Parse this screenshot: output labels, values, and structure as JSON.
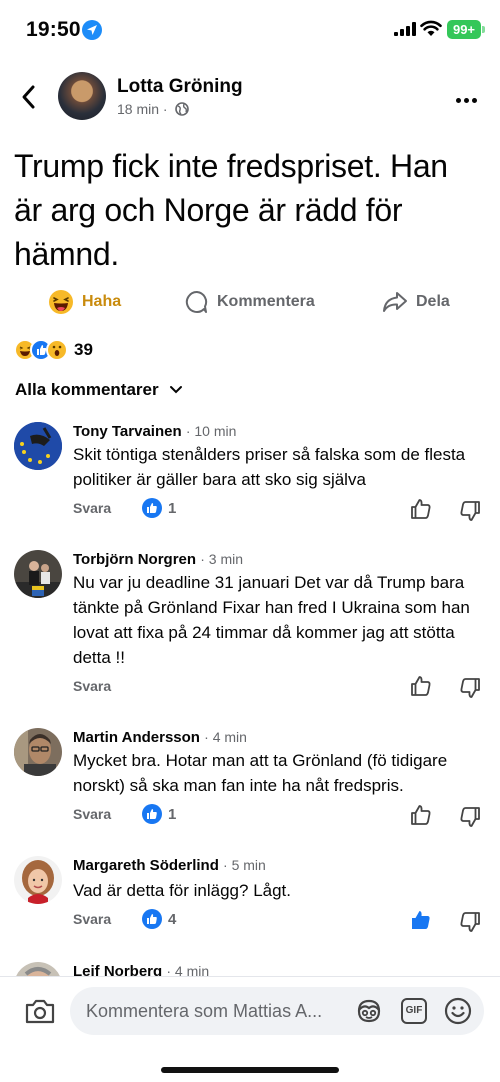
{
  "status_bar": {
    "time": "19:50",
    "battery": "99+"
  },
  "post": {
    "author": "Lotta Gröning",
    "time": "18 min",
    "separator": "·",
    "text": "Trump fick inte fredspriset. Han är arg och Norge är rädd för hämnd."
  },
  "actions": {
    "haha": "Haha",
    "comment": "Kommentera",
    "share": "Dela"
  },
  "reactions": {
    "count": "39",
    "types": [
      "haha-icon",
      "like-icon",
      "wow-icon"
    ]
  },
  "filter": {
    "label": "Alla kommentarer"
  },
  "comments": [
    {
      "name": "Tony Tarvainen",
      "time": "· 10 min",
      "text": "Skit töntiga stenålders priser så falska som de flesta politiker är gäller bara att sko sig själva",
      "reply": "Svara",
      "likes": "1"
    },
    {
      "name": "Torbjörn Norgren",
      "time": "· 3 min",
      "text": "Nu var ju deadline 31 januari Det var då Trump bara tänkte på Grönland Fixar han fred I Ukraina som han lovat att fixa på 24 timmar då kommer jag att stötta detta !!",
      "reply": "Svara",
      "likes": ""
    },
    {
      "name": "Martin Andersson",
      "time": "· 4 min",
      "text": "Mycket bra. Hotar man att ta Grönland (fö tidigare norskt) så ska man fan inte ha nåt fredspris.",
      "reply": "Svara",
      "likes": "1"
    },
    {
      "name": "Margareth Söderlind",
      "time": "· 5 min",
      "text": "Vad är detta för inlägg? Lågt.",
      "reply": "Svara",
      "likes": "4"
    },
    {
      "name": "Leif Norberg",
      "time": "· 4 min"
    }
  ],
  "composer": {
    "placeholder": "Kommentera som Mattias A..."
  },
  "colors": {
    "accent": "#1877f2",
    "haha": "#c98b0d",
    "battery": "#34c759"
  }
}
